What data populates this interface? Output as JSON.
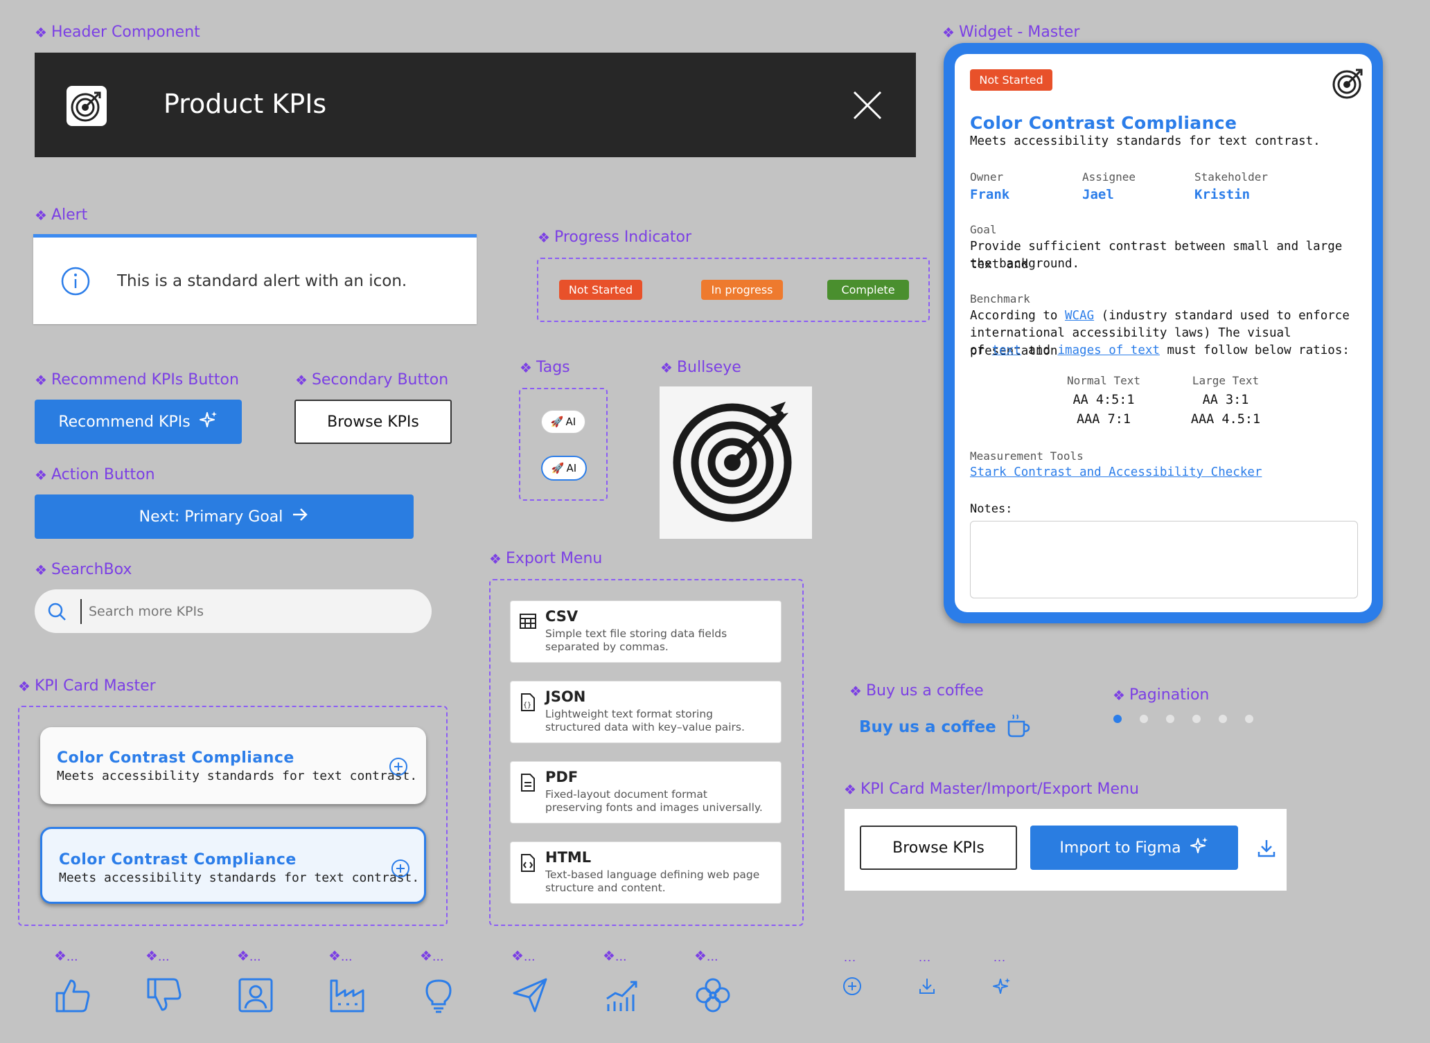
{
  "colors": {
    "background": "#c3c3c3",
    "accent": "#2b7de9",
    "label": "#7b3fe4",
    "not_started": "#e8512a",
    "in_progress": "#ee7a2e",
    "complete": "#4a8f2e",
    "header_bg": "#272727"
  },
  "labels": {
    "header": "Header Component",
    "alert": "Alert",
    "progress": "Progress Indicator",
    "recommend": "Recommend KPIs Button",
    "secondary": "Secondary Button",
    "tags": "Tags",
    "bullseye": "Bullseye",
    "action": "Action Button",
    "searchbox": "SearchBox",
    "export": "Export Menu",
    "kpi_master": "KPI Card Master",
    "coffee": "Buy us a coffee",
    "pagination": "Pagination",
    "kpi_import": "KPI Card Master/Import/Export Menu",
    "widget": "Widget - Master",
    "icon_label": "❖...",
    "dots": "..."
  },
  "header": {
    "title": "Product KPIs",
    "logo_icon": "target-icon",
    "close_icon": "close-icon"
  },
  "alert": {
    "text": "This is a standard alert with an icon.",
    "icon": "info-icon"
  },
  "progress": {
    "not_started": "Not Started",
    "in_progress": "In progress",
    "complete": "Complete"
  },
  "buttons": {
    "recommend": "Recommend KPIs",
    "browse": "Browse KPIs",
    "next": "Next: Primary Goal"
  },
  "tags": [
    {
      "emoji": "🚀",
      "text": "AI"
    },
    {
      "emoji": "🚀",
      "text": "AI"
    }
  ],
  "search": {
    "placeholder": "Search more KPIs"
  },
  "export_menu": [
    {
      "title": "CSV",
      "desc": "Simple text file storing data fields separated by commas.",
      "icon": "table-icon"
    },
    {
      "title": "JSON",
      "desc": "Lightweight text format storing structured data with key–value pairs.",
      "icon": "json-file-icon"
    },
    {
      "title": "PDF",
      "desc": "Fixed-layout document format preserving fonts and images universally.",
      "icon": "document-icon"
    },
    {
      "title": "HTML",
      "desc": "Text-based language defining web page structure and content.",
      "icon": "code-file-icon"
    }
  ],
  "kpi_cards": [
    {
      "title": "Color Contrast Compliance",
      "desc": "Meets accessibility standards for text contrast."
    },
    {
      "title": "Color Contrast Compliance",
      "desc": "Meets accessibility standards for text contrast."
    }
  ],
  "coffee": {
    "text": "Buy us a coffee"
  },
  "pagination": {
    "pages": 6,
    "current": 1
  },
  "import_bar": {
    "browse": "Browse KPIs",
    "import": "Import to Figma"
  },
  "widget": {
    "status": "Not Started",
    "title": "Color Contrast Compliance",
    "subtitle": "Meets accessibility standards for text contrast.",
    "owner_label": "Owner",
    "owner": "Frank",
    "assignee_label": "Assignee",
    "assignee": "Jael",
    "stakeholder_label": "Stakeholder",
    "stakeholder": "Kristin",
    "goal_label": "Goal",
    "goal_line1": "Provide sufficient contrast between small and large text and",
    "goal_line2": "the background.",
    "benchmark_label": "Benchmark",
    "bm_p1": "According to ",
    "bm_link1": "WCAG",
    "bm_p2": " (industry standard used to enforce",
    "bm_line2": "international accessibility laws) The visual presentation",
    "bm_p3": "of ",
    "bm_link2": "text",
    "bm_p4": " and ",
    "bm_link3": "images of text",
    "bm_p5": " must follow below ratios:",
    "normal_label": "Normal Text",
    "normal_aa": "AA 4:5:1",
    "normal_aaa": "AAA 7:1",
    "large_label": "Large Text",
    "large_aa": "AA 3:1",
    "large_aaa": "AAA 4.5:1",
    "tools_label": "Measurement Tools",
    "tools_link": "Stark Contrast and Accessibility Checker",
    "notes_label": "Notes:"
  },
  "bottom_icons": [
    "thumbs-up-icon",
    "thumbs-down-icon",
    "user-portrait-icon",
    "factory-icon",
    "lightbulb-icon",
    "send-icon",
    "chart-growth-icon",
    "flower-icon"
  ],
  "small_icons": [
    "add-circle-icon",
    "download-icon",
    "sparkle-icon"
  ]
}
